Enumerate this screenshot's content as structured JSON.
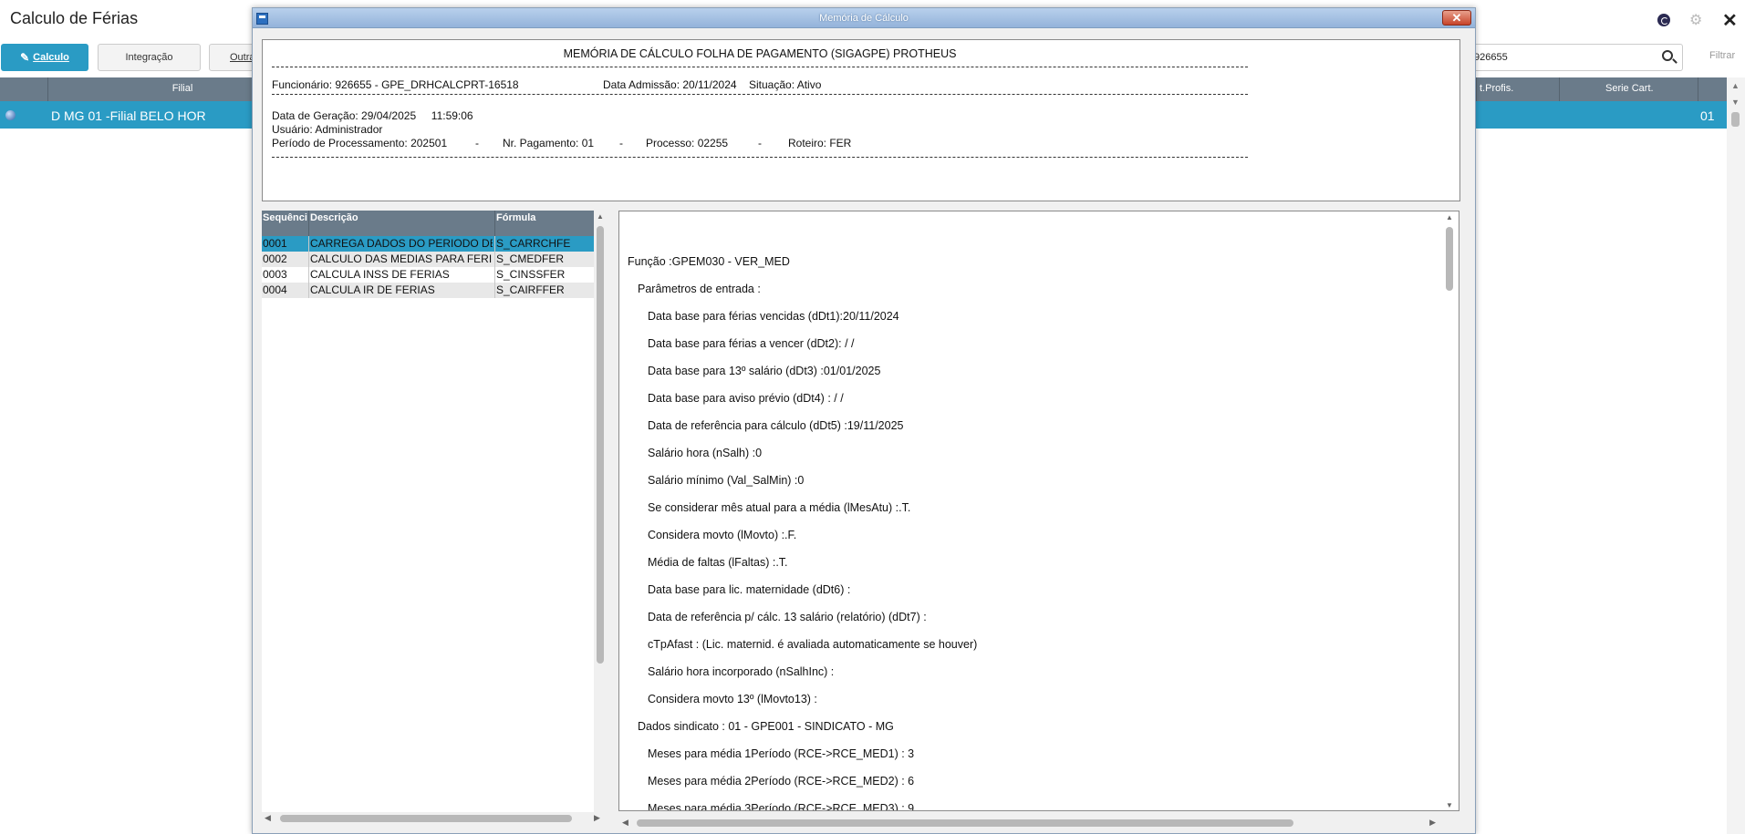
{
  "app": {
    "title": "Calculo de Férias",
    "buttons": {
      "calculo": "Calculo",
      "integracao": "Integração",
      "outras": "Outra"
    },
    "search_value": "926655",
    "filter_label": "Filtrar",
    "grid_headers": {
      "filial": "Filial",
      "cart_profis": "t.Profis.",
      "serie_cart": "Serie Cart."
    },
    "row": {
      "text": "D MG 01 -Filial BELO HOR",
      "value": "01"
    },
    "colors": {
      "accent": "#2a9bc4",
      "header": "#6a7b8a"
    }
  },
  "dialog": {
    "title": "Memória de Cálculo",
    "header": {
      "title": "MEMÓRIA DE CÁLCULO FOLHA DE PAGAMENTO (SIGAGPE) PROTHEUS",
      "funcionario": "Funcionário: 926655 - GPE_DRHCALCPRT-16518",
      "data_admissao": "Data Admissão: 20/11/2024",
      "situacao": "Situação: Ativo",
      "data_geracao": "Data de Geração: 29/04/2025     11:59:06",
      "usuario": "Usuário: Administrador",
      "periodo": "Período de Processamento: 202501",
      "nr_pagamento": "Nr. Pagamento: 01",
      "processo": "Processo: 02255",
      "roteiro": "Roteiro: FER",
      "sep": "-"
    },
    "table": {
      "headers": [
        "Sequênci",
        "Descrição",
        "Fórmula"
      ],
      "rows": [
        [
          "0001",
          "CARREGA DADOS DO PERIODO DE",
          "S_CARRCHFE"
        ],
        [
          "0002",
          "CALCULO DAS MEDIAS PARA FERI",
          "S_CMEDFER"
        ],
        [
          "0003",
          "CALCULA INSS DE FERIAS",
          "S_CINSSFER"
        ],
        [
          "0004",
          "CALCULA IR DE FERIAS",
          "S_CAIRFFER"
        ]
      ]
    },
    "detail_lines": [
      "Função :GPEM030 - VER_MED",
      "Parâmetros de entrada :",
      "Data base para férias vencidas (dDt1):20/11/2024",
      "Data base para férias a vencer (dDt2):  /  /",
      "Data base para 13º salário (dDt3) :01/01/2025",
      "Data base para aviso prévio (dDt4) :  /  /",
      "Data de referência para cálculo (dDt5) :19/11/2025",
      "Salário hora (nSalh) :0",
      "Salário mínimo (Val_SalMin) :0",
      "Se considerar mês atual para a média (lMesAtu) :.T.",
      "Considera movto (lMovto) :.F.",
      "Média de faltas (lFaltas) :.T.",
      "Data base para lic. maternidade (dDt6) :",
      "Data de referência p/ cálc. 13 salário (relatório) (dDt7) :",
      "cTpAfast : (Lic. maternid. é avaliada automaticamente se houver)",
      "Salário hora incorporado (nSalhInc) :",
      "Considera movto 13º (lMovto13) :",
      "Dados sindicato : 01 - GPE001 - SINDICATO - MG",
      "Meses para média 1Período (RCE->RCE_MED1) : 3",
      "Meses para média 2Período (RCE->RCE_MED2) : 6",
      "Meses para média 3Período (RCE->RCE_MED3) : 9"
    ]
  }
}
